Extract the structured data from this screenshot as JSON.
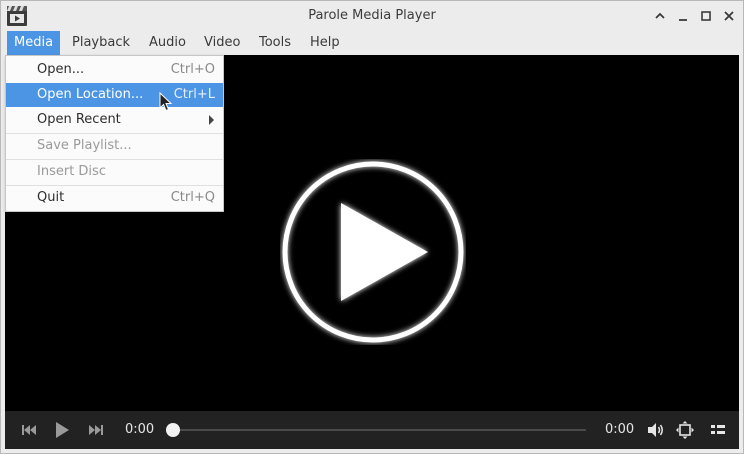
{
  "window": {
    "title": "Parole Media Player"
  },
  "menubar": {
    "items": [
      {
        "label": "Media",
        "active": true
      },
      {
        "label": "Playback"
      },
      {
        "label": "Audio"
      },
      {
        "label": "Video"
      },
      {
        "label": "Tools"
      },
      {
        "label": "Help"
      }
    ]
  },
  "media_menu": {
    "items": [
      {
        "label": "Open...",
        "shortcut": "Ctrl+O"
      },
      {
        "label": "Open Location...",
        "shortcut": "Ctrl+L",
        "highlighted": true
      },
      {
        "label": "Open Recent",
        "submenu": true
      },
      {
        "label": "Save Playlist...",
        "disabled": true
      },
      {
        "label": "Insert Disc",
        "disabled": true
      },
      {
        "label": "Quit",
        "shortcut": "Ctrl+Q"
      }
    ]
  },
  "controls": {
    "elapsed": "0:00",
    "duration": "0:00",
    "progress": 0
  },
  "colors": {
    "accent": "#4c95e4",
    "video_bg": "#000000",
    "controls_bg": "#222222"
  }
}
